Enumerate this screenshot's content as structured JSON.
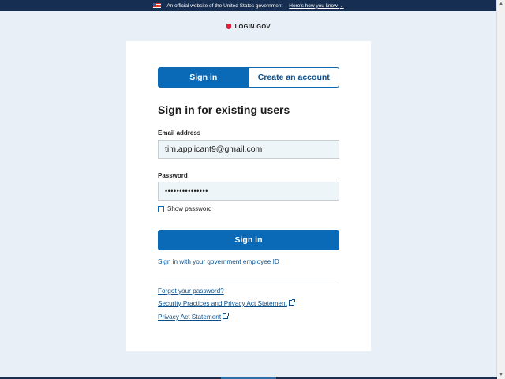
{
  "banner": {
    "text": "An official website of the United States government",
    "link": "Here's how you know",
    "chevron": "⌄"
  },
  "logo": {
    "text": "LOGIN.GOV"
  },
  "tabs": [
    {
      "label": "Sign in",
      "active": true
    },
    {
      "label": "Create an account",
      "active": false
    }
  ],
  "form": {
    "heading": "Sign in for existing users",
    "email_label": "Email address",
    "email_value": "tim.applicant9@gmail.com",
    "password_label": "Password",
    "password_value": "•••••••••••••••",
    "show_password_label": "Show password",
    "submit_label": "Sign in"
  },
  "links": {
    "piv": "Sign in with your government employee ID",
    "forgot": "Forgot your password?",
    "security": "Security Practices and Privacy Act Statement",
    "privacy": "Privacy Act Statement"
  },
  "colors": {
    "primary": "#0b6ab8",
    "banner": "#162e51",
    "page_bg": "#e8eff7",
    "shield": "#e21c3d"
  },
  "icons": [
    "us-flag-icon",
    "chevron-down-icon",
    "login-shield-icon",
    "external-link-icon"
  ]
}
